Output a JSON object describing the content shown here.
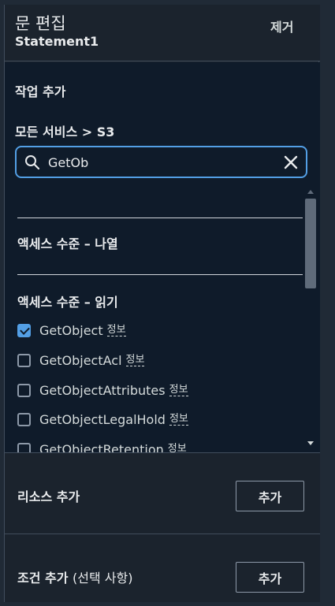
{
  "header": {
    "title": "문 편집",
    "subtitle": "Statement1",
    "remove_label": "제거"
  },
  "actions": {
    "title": "작업 추가",
    "breadcrumb": "모든 서비스 > S3",
    "search": {
      "value": "GetOb",
      "placeholder": ""
    },
    "groups": [
      {
        "title": "액세스 수준 – 나열",
        "items": []
      },
      {
        "title": "액세스 수준 – 읽기",
        "items": [
          {
            "label": "GetObject",
            "info": "정보",
            "checked": true
          },
          {
            "label": "GetObjectAcl",
            "info": "정보",
            "checked": false
          },
          {
            "label": "GetObjectAttributes",
            "info": "정보",
            "checked": false
          },
          {
            "label": "GetObjectLegalHold",
            "info": "정보",
            "checked": false
          },
          {
            "label": "GetObjectRetention",
            "info": "정보",
            "checked": false
          }
        ]
      }
    ]
  },
  "resource": {
    "label": "리소스 추가",
    "button_label": "추가"
  },
  "condition": {
    "label": "조건 추가",
    "optional_label": "(선택 사항)",
    "button_label": "추가"
  },
  "colors": {
    "accent": "#539fe5",
    "panel_bg": "#1b232d",
    "list_bg": "#0f1b2a"
  }
}
